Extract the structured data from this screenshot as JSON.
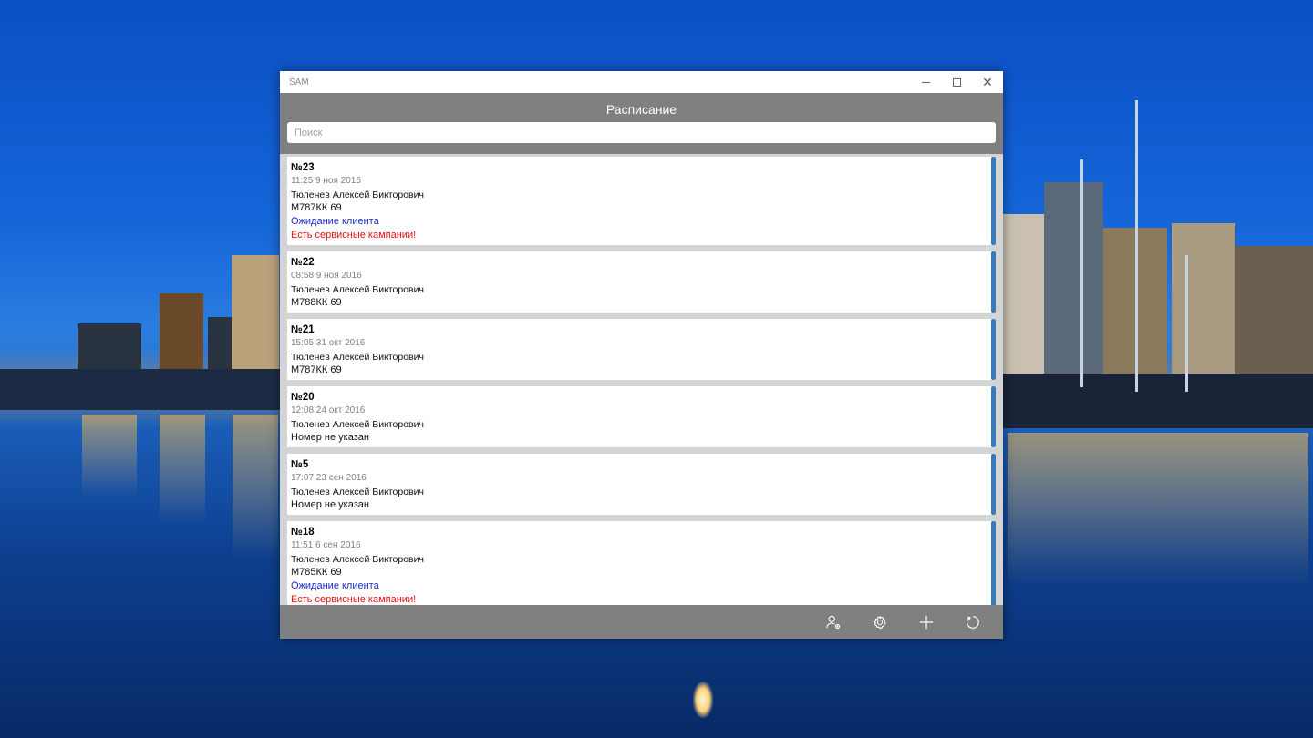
{
  "window": {
    "app_name": "SAM",
    "controls": {
      "minimize": "minimize",
      "maximize": "maximize",
      "close": "✕"
    }
  },
  "header": {
    "title": "Расписание",
    "search_placeholder": "Поиск",
    "search_value": ""
  },
  "orders": [
    {
      "number": "№23",
      "time": "11:25  9 ноя 2016",
      "client": "Тюленев Алексей Викторович",
      "plate": "М787КК 69",
      "status": "Ожидание клиента",
      "warning": "Есть сервисные кампании!"
    },
    {
      "number": "№22",
      "time": "08:58  9 ноя 2016",
      "client": "Тюленев Алексей Викторович",
      "plate": "М788КК 69",
      "status": "",
      "warning": ""
    },
    {
      "number": "№21",
      "time": "15:05  31 окт 2016",
      "client": "Тюленев Алексей Викторович",
      "plate": "М787КК 69",
      "status": "",
      "warning": ""
    },
    {
      "number": "№20",
      "time": "12:08  24 окт 2016",
      "client": "Тюленев Алексей Викторович",
      "plate": "Номер не указан",
      "status": "",
      "warning": ""
    },
    {
      "number": "№5",
      "time": "17:07  23 сен 2016",
      "client": "Тюленев Алексей Викторович",
      "plate": "Номер не указан",
      "status": "",
      "warning": ""
    },
    {
      "number": "№18",
      "time": "11:51  6 сен 2016",
      "client": "Тюленев Алексей Викторович",
      "plate": "М785КК 69",
      "status": "Ожидание клиента",
      "warning": "Есть сервисные кампании!"
    }
  ],
  "toolbar": {
    "icons": [
      "user-settings-icon",
      "gear-icon",
      "plus-icon",
      "refresh-icon"
    ]
  },
  "colors": {
    "header_bg": "#808080",
    "accent_bar": "#3a7ab8",
    "status_text": "#1c2bd0",
    "warning_text": "#e81010"
  }
}
